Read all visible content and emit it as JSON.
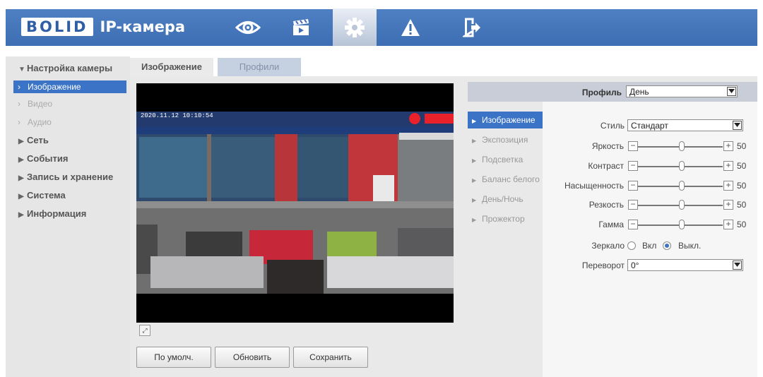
{
  "header": {
    "brand": "BOLID",
    "title": "IP-камера",
    "nav": [
      {
        "icon": "eye-icon"
      },
      {
        "icon": "clapperboard-icon"
      },
      {
        "icon": "gear-icon",
        "active": true
      },
      {
        "icon": "warning-icon"
      },
      {
        "icon": "logout-icon"
      }
    ]
  },
  "sidebar": {
    "camera_section": "Настройка камеры",
    "camera_items": [
      "Изображение",
      "Видео",
      "Аудио"
    ],
    "sections": [
      "Сеть",
      "События",
      "Запись и хранение",
      "Система",
      "Информация"
    ]
  },
  "tabs": [
    "Изображение",
    "Профили"
  ],
  "video": {
    "timestamp": "2020.11.12 10:10:54"
  },
  "buttons": {
    "default": "По умолч.",
    "refresh": "Обновить",
    "save": "Сохранить"
  },
  "profile": {
    "label": "Профиль",
    "value": "День"
  },
  "submenu": [
    "Изображение",
    "Экспозиция",
    "Подсветка",
    "Баланс белого",
    "День/Ночь",
    "Прожектор"
  ],
  "form": {
    "style_label": "Стиль",
    "style_value": "Стандарт",
    "sliders": [
      {
        "label": "Яркость",
        "value": "50"
      },
      {
        "label": "Контраст",
        "value": "50"
      },
      {
        "label": "Насыщенность",
        "value": "50"
      },
      {
        "label": "Резкость",
        "value": "50"
      },
      {
        "label": "Гамма",
        "value": "50"
      }
    ],
    "minus": "−",
    "plus": "+",
    "mirror_label": "Зеркало",
    "mirror_on": "Вкл",
    "mirror_off": "Выкл.",
    "flip_label": "Переворот",
    "flip_value": "0°"
  },
  "colors": {
    "header_blue": "#3d6db2",
    "accent": "#3b74c7"
  }
}
